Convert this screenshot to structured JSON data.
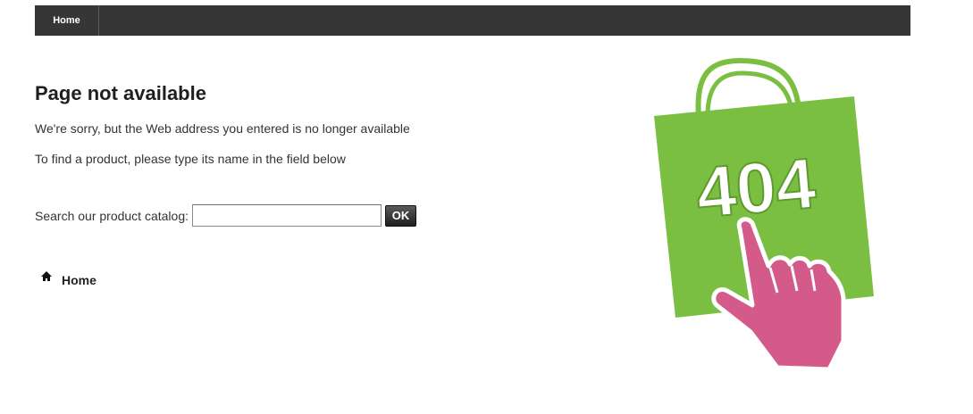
{
  "topbar": {
    "nav": [
      {
        "label": "Home"
      }
    ]
  },
  "main": {
    "title": "Page not available",
    "message1": "We're sorry, but the Web address you entered is no longer available",
    "message2": "To find a product, please type its name in the field below",
    "search": {
      "label": "Search our product catalog:",
      "value": "",
      "placeholder": "",
      "button_label": "OK"
    },
    "home_link": {
      "label": "Home",
      "icon": "home-icon"
    }
  },
  "illustration": {
    "code": "404",
    "icon": "shopping-bag-hand-pointer-icon",
    "colors": {
      "bag": "#7bbf42",
      "handle": "#7bbf42",
      "hand": "#d45a8a",
      "text": "#ffffff"
    }
  },
  "colors": {
    "topbar": "#363636",
    "button": "#2a2a2a"
  }
}
